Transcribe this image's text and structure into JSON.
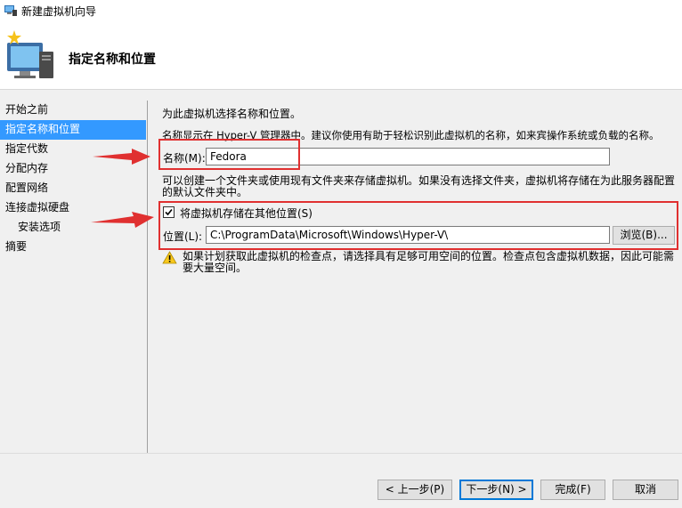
{
  "window": {
    "title": "新建虚拟机向导"
  },
  "header": {
    "heading": "指定名称和位置"
  },
  "nav": {
    "items": [
      {
        "label": "开始之前"
      },
      {
        "label": "指定名称和位置"
      },
      {
        "label": "指定代数"
      },
      {
        "label": "分配内存"
      },
      {
        "label": "配置网络"
      },
      {
        "label": "连接虚拟硬盘"
      },
      {
        "label": "安装选项"
      },
      {
        "label": "摘要"
      }
    ]
  },
  "main": {
    "intro": "为此虚拟机选择名称和位置。",
    "name_hint": "名称显示在 Hyper-V 管理器中。建议你使用有助于轻松识别此虚拟机的名称，如来宾操作系统或负载的名称。",
    "name_label": "名称(M):",
    "name_value": "Fedora",
    "folder_hint": "可以创建一个文件夹或使用现有文件夹来存储虚拟机。如果没有选择文件夹，虚拟机将存储在为此服务器配置的默认文件夹中。",
    "store_checkbox_label": "将虚拟机存储在其他位置(S)",
    "store_checked": true,
    "location_label": "位置(L):",
    "location_value": "C:\\ProgramData\\Microsoft\\Windows\\Hyper-V\\",
    "browse_label": "浏览(B)...",
    "warning_text": "如果计划获取此虚拟机的检查点，请选择具有足够可用空间的位置。检查点包含虚拟机数据，因此可能需要大量空间。"
  },
  "footer": {
    "prev_label": "< 上一步(P)",
    "next_label": "下一步(N) >",
    "finish_label": "完成(F)",
    "cancel_label": "取消"
  },
  "colors": {
    "selection": "#3399ff",
    "annotation": "#e03030"
  }
}
